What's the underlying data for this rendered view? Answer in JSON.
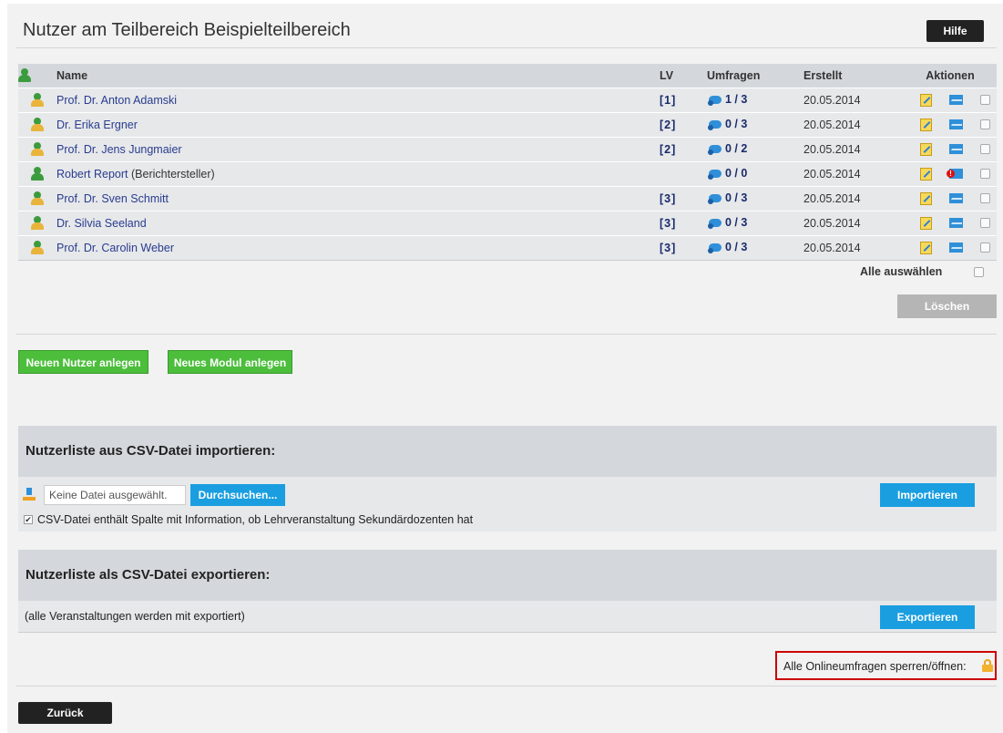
{
  "page": {
    "title": "Nutzer am Teilbereich Beispielteilbereich",
    "help_label": "Hilfe"
  },
  "table": {
    "headers": {
      "name": "Name",
      "lv": "LV",
      "umfragen": "Umfragen",
      "erstellt": "Erstellt",
      "aktionen": "Aktionen"
    },
    "rows": [
      {
        "name": "Prof. Dr. Anton Adamski",
        "role": "",
        "lv": "[1]",
        "umfragen": "1 / 3",
        "erstellt": "20.05.2014",
        "icon": "yellow",
        "mail": "mail"
      },
      {
        "name": "Dr. Erika Ergner",
        "role": "",
        "lv": "[2]",
        "umfragen": "0 / 3",
        "erstellt": "20.05.2014",
        "icon": "yellow",
        "mail": "mail"
      },
      {
        "name": "Prof. Dr. Jens Jungmaier",
        "role": "",
        "lv": "[2]",
        "umfragen": "0 / 2",
        "erstellt": "20.05.2014",
        "icon": "yellow",
        "mail": "mail"
      },
      {
        "name": "Robert Report",
        "role": "(Berichtersteller)",
        "lv": "",
        "umfragen": "0 / 0",
        "erstellt": "20.05.2014",
        "icon": "green",
        "mail": "mail-error"
      },
      {
        "name": "Prof. Dr. Sven Schmitt",
        "role": "",
        "lv": "[3]",
        "umfragen": "0 / 3",
        "erstellt": "20.05.2014",
        "icon": "yellow",
        "mail": "mail"
      },
      {
        "name": "Dr. Silvia Seeland",
        "role": "",
        "lv": "[3]",
        "umfragen": "0 / 3",
        "erstellt": "20.05.2014",
        "icon": "yellow",
        "mail": "mail"
      },
      {
        "name": "Prof. Dr. Carolin Weber",
        "role": "",
        "lv": "[3]",
        "umfragen": "0 / 3",
        "erstellt": "20.05.2014",
        "icon": "yellow",
        "mail": "mail"
      }
    ],
    "select_all_label": "Alle auswählen",
    "delete_label": "Löschen"
  },
  "actions": {
    "new_user_label": "Neuen Nutzer anlegen",
    "new_module_label": "Neues Modul anlegen"
  },
  "import": {
    "heading": "Nutzerliste aus CSV-Datei importieren:",
    "file_name": "Keine Datei ausgewählt.",
    "browse_label": "Durchsuchen...",
    "import_label": "Importieren",
    "checkbox_label": "CSV-Datei enthält Spalte mit Information, ob Lehrveranstaltung Sekundärdozenten hat",
    "checkbox_checked": true
  },
  "export": {
    "heading": "Nutzerliste als CSV-Datei exportieren:",
    "note": "(alle Veranstaltungen werden mit exportiert)",
    "export_label": "Exportieren"
  },
  "lock": {
    "label": "Alle Onlineumfragen sperren/öffnen:"
  },
  "footer": {
    "back_label": "Zurück"
  },
  "colors": {
    "green_button": "#4cbe3c",
    "blue_button": "#1a9ee0",
    "link": "#2a3c8f",
    "highlight_border": "#cc0000"
  }
}
